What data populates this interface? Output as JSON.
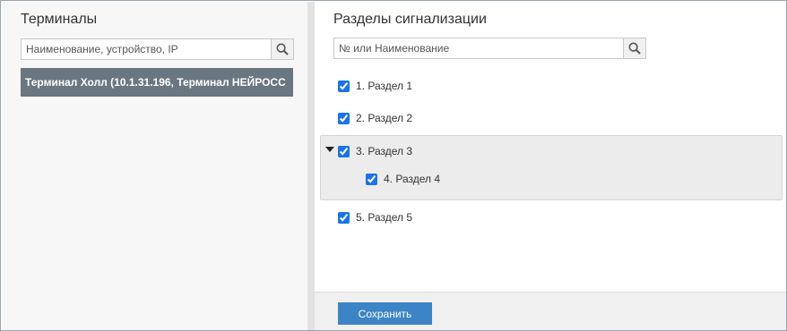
{
  "terminals": {
    "title": "Терминалы",
    "search_placeholder": "Наименование, устройство, IP",
    "items": [
      {
        "label": "Терминал Холл (10.1.31.196, Терминал НЕЙРОСС"
      }
    ]
  },
  "sections": {
    "title": "Разделы сигнализации",
    "search_placeholder": "№ или Наименование",
    "items": [
      {
        "label": "1. Раздел 1",
        "checked": true
      },
      {
        "label": "2. Раздел 2",
        "checked": true
      },
      {
        "label": "3. Раздел 3",
        "checked": true,
        "expanded": true
      },
      {
        "label": "4. Раздел 4",
        "checked": true
      },
      {
        "label": "5. Раздел 5",
        "checked": true
      }
    ]
  },
  "footer": {
    "save_label": "Сохранить"
  },
  "icons": {
    "search": "search-icon",
    "expand": "caret-down-icon"
  },
  "colors": {
    "accent": "#3d84c6",
    "selected_row": "#6a7680",
    "checkbox": "#1a73e8"
  }
}
